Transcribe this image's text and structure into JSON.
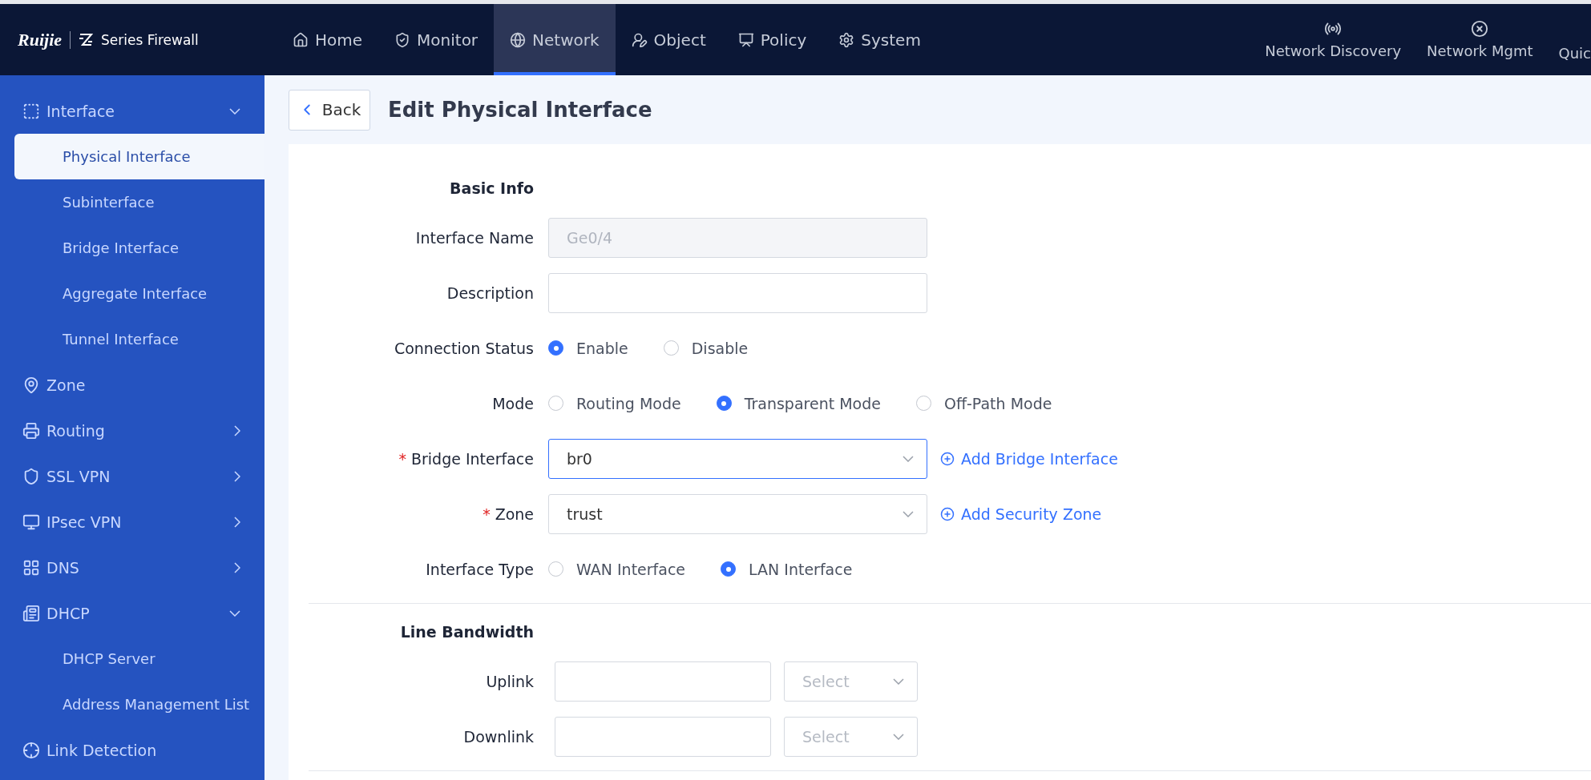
{
  "brand": {
    "logo": "Ruijie",
    "product": "Series Firewall"
  },
  "nav": [
    {
      "label": "Home",
      "selected": false
    },
    {
      "label": "Monitor",
      "selected": false
    },
    {
      "label": "Network",
      "selected": true
    },
    {
      "label": "Object",
      "selected": false
    },
    {
      "label": "Policy",
      "selected": false
    },
    {
      "label": "System",
      "selected": false
    }
  ],
  "tools": [
    {
      "label": "Network Discovery"
    },
    {
      "label": "Network Mgmt"
    },
    {
      "label": "Quic"
    }
  ],
  "sidebar": {
    "items": [
      {
        "label": "Interface",
        "kind": "group",
        "expanded": true,
        "children": [
          {
            "label": "Physical Interface",
            "selected": true
          },
          {
            "label": "Subinterface",
            "selected": false
          },
          {
            "label": "Bridge Interface",
            "selected": false
          },
          {
            "label": "Aggregate Interface",
            "selected": false
          },
          {
            "label": "Tunnel Interface",
            "selected": false
          }
        ]
      },
      {
        "label": "Zone",
        "kind": "leaf"
      },
      {
        "label": "Routing",
        "kind": "group",
        "expanded": false
      },
      {
        "label": "SSL VPN",
        "kind": "group",
        "expanded": false
      },
      {
        "label": "IPsec VPN",
        "kind": "group",
        "expanded": false
      },
      {
        "label": "DNS",
        "kind": "group",
        "expanded": false
      },
      {
        "label": "DHCP",
        "kind": "group",
        "expanded": true,
        "children": [
          {
            "label": "DHCP Server",
            "selected": false
          },
          {
            "label": "Address Management List",
            "selected": false
          }
        ]
      },
      {
        "label": "Link Detection",
        "kind": "leaf"
      }
    ]
  },
  "page": {
    "back": "Back",
    "title": "Edit Physical Interface"
  },
  "sections": [
    {
      "title": "Basic Info",
      "rows": [
        {
          "kind": "input",
          "label": "Interface Name",
          "value": "Ge0/4",
          "disabled": true
        },
        {
          "kind": "input",
          "label": "Description"
        },
        {
          "kind": "radio",
          "label": "Connection Status",
          "options": [
            {
              "label": "Enable",
              "selected": true
            },
            {
              "label": "Disable",
              "selected": false
            }
          ]
        },
        {
          "kind": "radio",
          "label": "Mode",
          "options": [
            {
              "label": "Routing Mode",
              "selected": false
            },
            {
              "label": "Transparent Mode",
              "selected": true
            },
            {
              "label": "Off-Path Mode",
              "selected": false
            }
          ]
        },
        {
          "kind": "select",
          "label": "Bridge Interface",
          "required_mark": "*",
          "value": "br0",
          "focused": true,
          "link": "Add Bridge Interface"
        },
        {
          "kind": "select",
          "label": "Zone",
          "required_mark": "*",
          "value": "trust",
          "focused": false,
          "link": "Add Security Zone"
        },
        {
          "kind": "radio",
          "label": "Interface Type",
          "options": [
            {
              "label": "WAN Interface",
              "selected": false
            },
            {
              "label": "LAN Interface",
              "selected": true
            }
          ]
        }
      ]
    },
    {
      "title": "Line Bandwidth",
      "rows": [
        {
          "kind": "bandwidth",
          "label": "Uplink",
          "placeholder": "Select"
        },
        {
          "kind": "bandwidth",
          "label": "Downlink",
          "placeholder": "Select"
        }
      ]
    }
  ]
}
